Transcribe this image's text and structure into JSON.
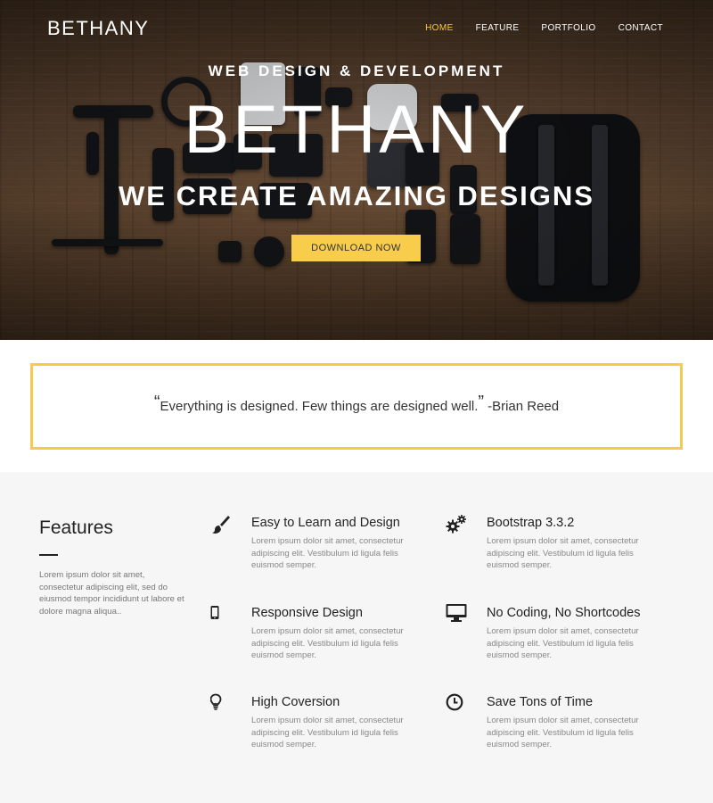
{
  "brand": "BETHANY",
  "nav": {
    "items": [
      {
        "label": "HOME",
        "active": true
      },
      {
        "label": "FEATURE",
        "active": false
      },
      {
        "label": "PORTFOLIO",
        "active": false
      },
      {
        "label": "CONTACT",
        "active": false
      }
    ]
  },
  "hero": {
    "tagline": "WEB DESIGN & DEVELOPMENT",
    "title": "BETHANY",
    "subtitle": "WE CREATE AMAZING DESIGNS",
    "cta_label": "DOWNLOAD NOW"
  },
  "quote": {
    "open_mark": "“",
    "text": "Everything is designed. Few things are designed well.",
    "close_mark": "”",
    "author": "-Brian Reed"
  },
  "features": {
    "title": "Features",
    "intro": "Lorem ipsum dolor sit amet, consectetur adipiscing elit, sed do eiusmod tempor incididunt ut labore et dolore magna aliqua..",
    "items": [
      {
        "icon": "paintbrush-icon",
        "title": "Easy to Learn and Design",
        "desc": "Lorem ipsum dolor sit amet, consectetur adipiscing elit. Vestibulum id ligula felis euismod semper."
      },
      {
        "icon": "gears-icon",
        "title": "Bootstrap 3.3.2",
        "desc": "Lorem ipsum dolor sit amet, consectetur adipiscing elit. Vestibulum id ligula felis euismod semper."
      },
      {
        "icon": "mobile-phone-icon",
        "title": "Responsive Design",
        "desc": "Lorem ipsum dolor sit amet, consectetur adipiscing elit. Vestibulum id ligula felis euismod semper."
      },
      {
        "icon": "desktop-monitor-icon",
        "title": "No Coding, No Shortcodes",
        "desc": "Lorem ipsum dolor sit amet, consectetur adipiscing elit. Vestibulum id ligula felis euismod semper."
      },
      {
        "icon": "lightbulb-icon",
        "title": "High Coversion",
        "desc": "Lorem ipsum dolor sit amet, consectetur adipiscing elit. Vestibulum id ligula felis euismod semper."
      },
      {
        "icon": "clock-icon",
        "title": "Save Tons of Time",
        "desc": "Lorem ipsum dolor sit amet, consectetur adipiscing elit. Vestibulum id ligula felis euismod semper."
      }
    ]
  },
  "colors": {
    "accent": "#f5c842",
    "cta_background": "#f7cd4b",
    "quote_border": "#f5cb47",
    "features_background": "#f6f6f6"
  }
}
